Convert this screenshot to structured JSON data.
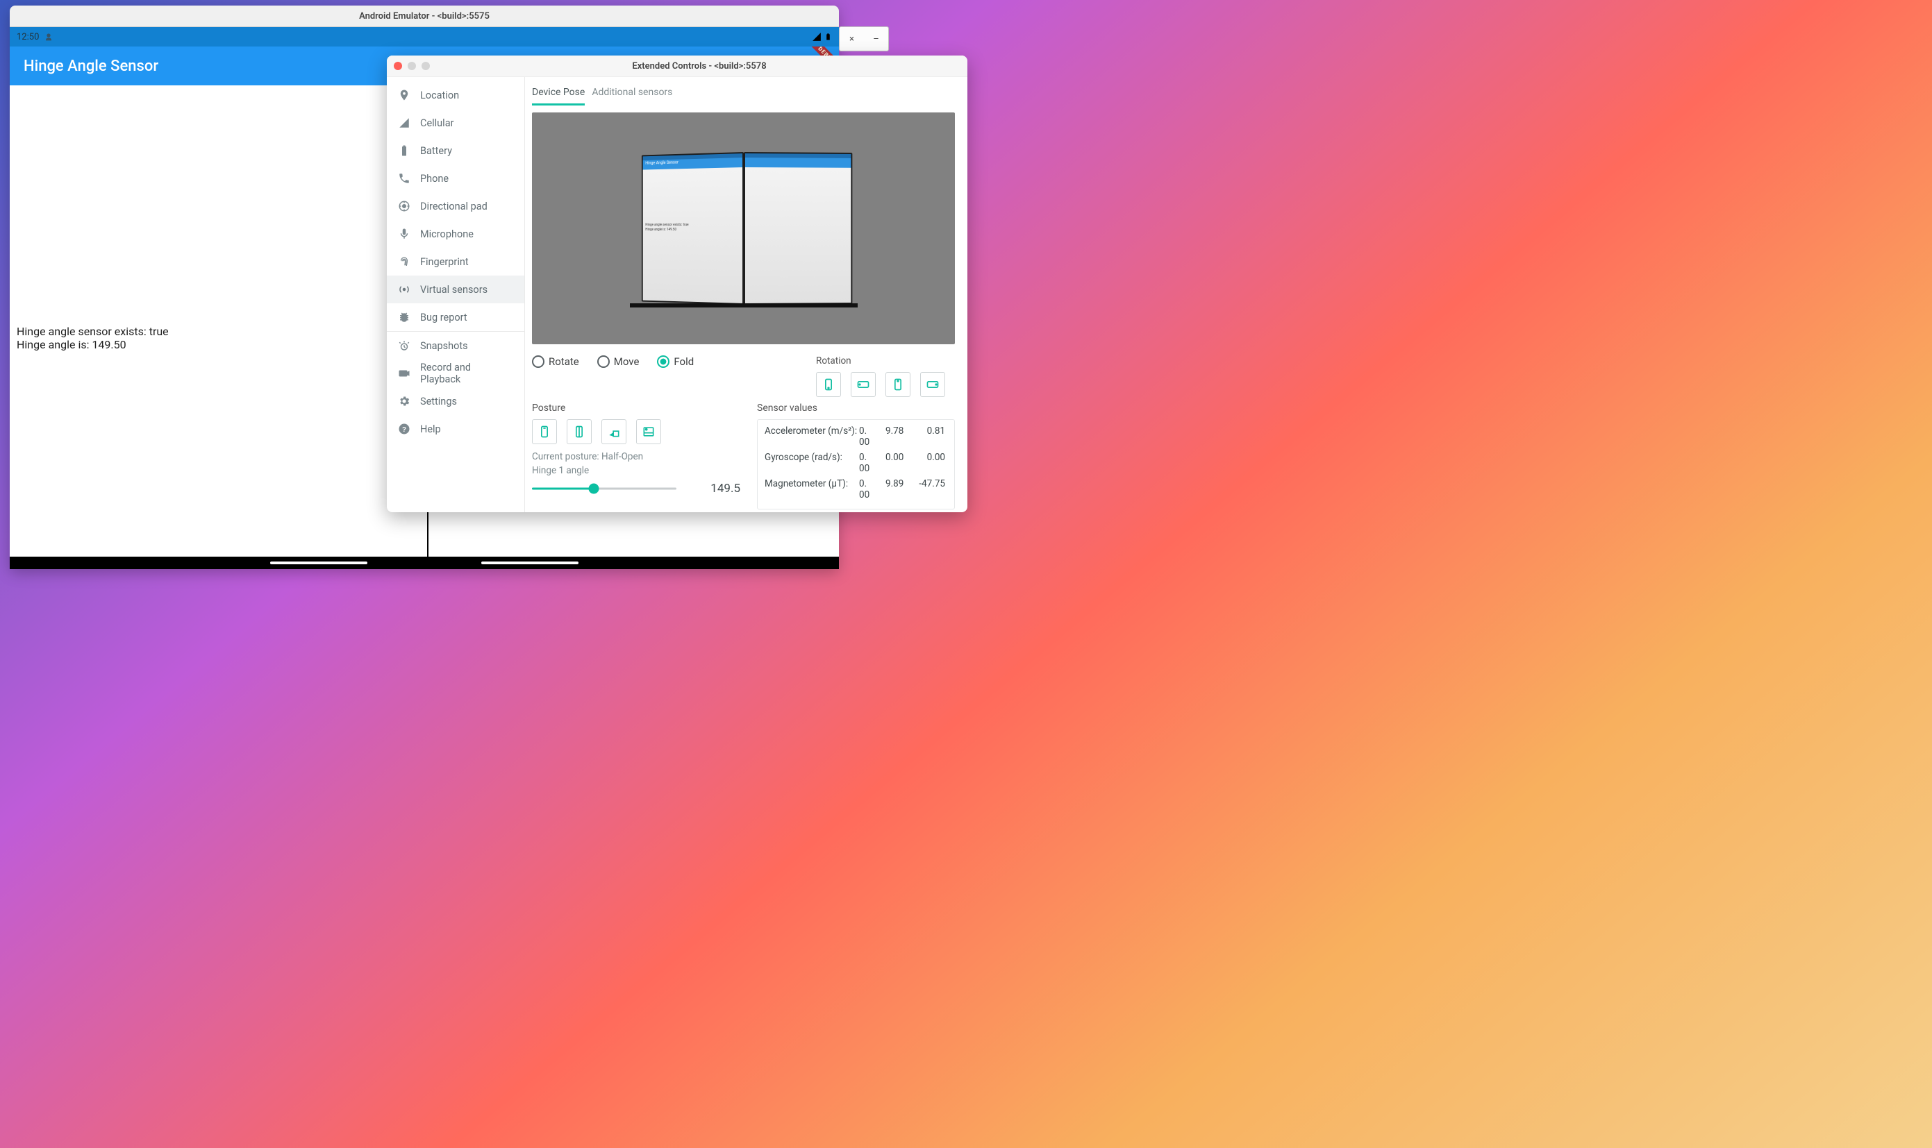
{
  "emulator": {
    "window_title": "Android Emulator - <build>:5575",
    "status_time": "12:50",
    "app_title": "Hinge Angle Sensor",
    "body_line1": "Hinge angle sensor exists: true",
    "body_line2": "Hinge angle is: 149.50",
    "debug_banner": "DEBUG"
  },
  "back_window": {
    "close": "×",
    "minimize": "–"
  },
  "extended": {
    "window_title": "Extended Controls - <build>:5578",
    "sidebar": [
      {
        "id": "location",
        "label": "Location"
      },
      {
        "id": "cellular",
        "label": "Cellular"
      },
      {
        "id": "battery",
        "label": "Battery"
      },
      {
        "id": "phone",
        "label": "Phone"
      },
      {
        "id": "directional-pad",
        "label": "Directional pad"
      },
      {
        "id": "microphone",
        "label": "Microphone"
      },
      {
        "id": "fingerprint",
        "label": "Fingerprint"
      },
      {
        "id": "virtual-sensors",
        "label": "Virtual sensors",
        "selected": true
      },
      {
        "id": "bug-report",
        "label": "Bug report"
      },
      {
        "id": "snapshots",
        "label": "Snapshots",
        "border": true
      },
      {
        "id": "record-and-playback",
        "label": "Record and Playback"
      },
      {
        "id": "settings",
        "label": "Settings"
      },
      {
        "id": "help",
        "label": "Help"
      }
    ],
    "tabs": {
      "device_pose": "Device Pose",
      "additional_sensors": "Additional sensors"
    },
    "preview": {
      "title": "Hinge Angle Sensor",
      "line1": "Hinge angle sensor exists: true",
      "line2": "Hinge angle is: 149.50"
    },
    "mode": {
      "rotate": "Rotate",
      "move": "Move",
      "fold": "Fold"
    },
    "rotation_label": "Rotation",
    "posture_label": "Posture",
    "current_posture_label": "Current posture: Half-Open",
    "hinge_label": "Hinge 1 angle",
    "hinge_value": "149.5",
    "hinge_fill_pct": 43,
    "sensor_values_label": "Sensor values",
    "sensors": {
      "accelerometer": {
        "label": "Accelerometer (m/s²):",
        "v": [
          "0.\n00",
          "9.78",
          "0.81"
        ]
      },
      "gyroscope": {
        "label": "Gyroscope (rad/s):",
        "v": [
          "0.\n00",
          "0.00",
          "0.00"
        ]
      },
      "magnetometer": {
        "label": "Magnetometer (μT):",
        "v": [
          "0.\n00",
          "9.89",
          "-47.75"
        ]
      }
    }
  }
}
